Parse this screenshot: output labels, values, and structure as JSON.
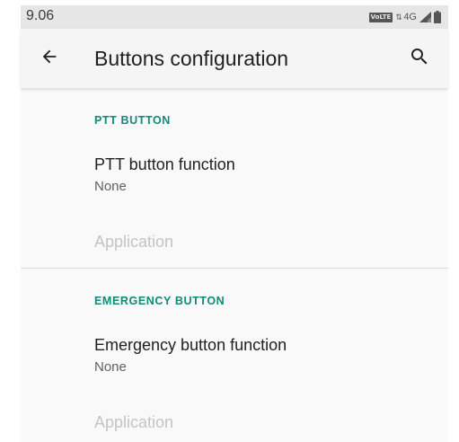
{
  "status_bar": {
    "time": "9.06",
    "volte": "VoLTE",
    "data_arrows": "⇅",
    "network": "4G",
    "icons": [
      "volte-icon",
      "data-activity-icon",
      "signal-icon",
      "battery-icon"
    ]
  },
  "app_bar": {
    "title": "Buttons configuration",
    "back_icon": "arrow-back-icon",
    "search_icon": "search-icon"
  },
  "sections": [
    {
      "header": "PTT BUTTON",
      "item": {
        "title": "PTT button function",
        "summary": "None"
      },
      "disabled_item": "Application"
    },
    {
      "header": "EMERGENCY BUTTON",
      "item": {
        "title": "Emergency button function",
        "summary": "None"
      },
      "disabled_item": "Application"
    }
  ],
  "colors": {
    "accent": "#0f8b78",
    "app_bar_bg": "#f5f5f5",
    "content_bg": "#f9f9f9",
    "status_bar_bg": "#e6e6e6",
    "disabled_text": "#c4c4c4"
  }
}
